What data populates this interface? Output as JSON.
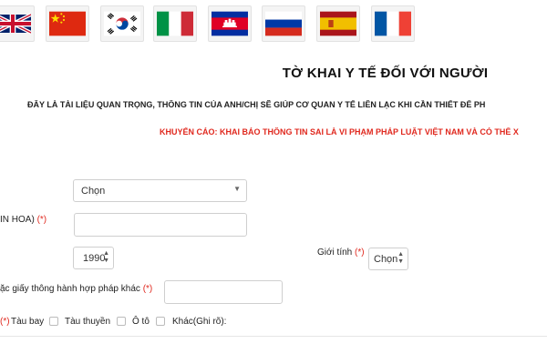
{
  "flags": [
    {
      "country": "United Kingdom",
      "icon": "uk-flag-icon"
    },
    {
      "country": "China",
      "icon": "china-flag-icon"
    },
    {
      "country": "South Korea",
      "icon": "south-korea-flag-icon"
    },
    {
      "country": "Italy",
      "icon": "italy-flag-icon"
    },
    {
      "country": "Cambodia",
      "icon": "cambodia-flag-icon"
    },
    {
      "country": "Russia",
      "icon": "russia-flag-icon"
    },
    {
      "country": "Spain",
      "icon": "spain-flag-icon"
    },
    {
      "country": "France",
      "icon": "france-flag-icon"
    }
  ],
  "header": {
    "title": "TỜ KHAI Y TẾ ĐỐI VỚI NGƯỜI",
    "subtitle": "ĐÂY LÀ TÀI LIỆU QUAN TRỌNG, THÔNG TIN CỦA ANH/CHỊ SẼ GIÚP CƠ QUAN Y TẾ LIÊN LẠC KHI CẦN THIẾT ĐỂ PH",
    "warning": "KHUYẾN CÁO: KHAI BÁO THÔNG TIN SAI LÀ VI PHẠM PHÁP LUẬT VIỆT NAM VÀ CÓ THỂ X"
  },
  "form": {
    "first_select": {
      "value": "Chọn"
    },
    "name": {
      "label": "IN HOA)",
      "required_mark": "(*)",
      "value": ""
    },
    "birth_year": {
      "value": "1990"
    },
    "gender": {
      "label": "Giới tính",
      "required_mark": "(*)",
      "value": "Chọn"
    },
    "passport": {
      "label": "ặc giấy thông hành hợp pháp khác",
      "required_mark": "(*)",
      "value": ""
    },
    "transport": {
      "required_mark": "(*)",
      "options": [
        "Tàu bay",
        "Tàu thuyền",
        "Ô tô",
        "Khác(Ghi rõ):"
      ]
    }
  },
  "colors": {
    "required": "#e0291f",
    "warning": "#e0291f"
  }
}
